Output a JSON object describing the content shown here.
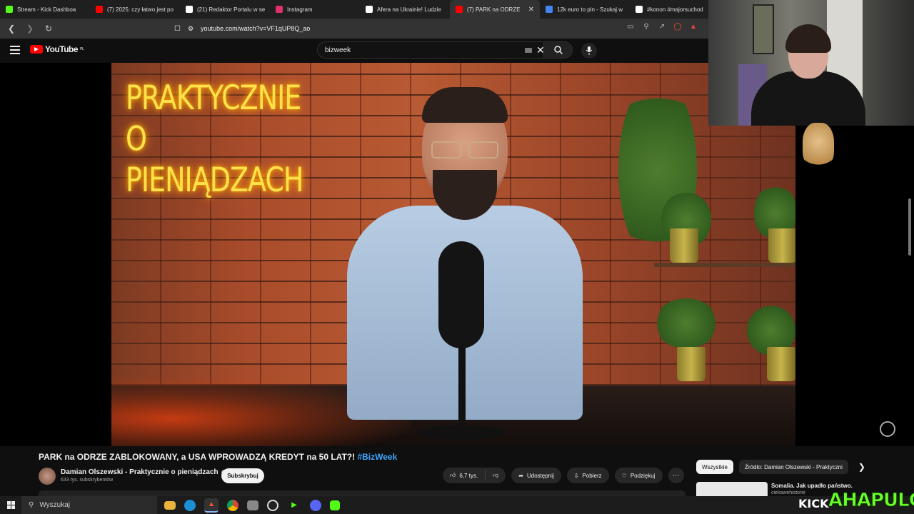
{
  "browser": {
    "tabs": [
      {
        "title": "Stream - Kick Dashboa",
        "icon": "kick-icon",
        "color": "#53fc18"
      },
      {
        "title": "(7) 2025: czy łatwo jest po",
        "icon": "youtube-icon",
        "color": "#ff0000"
      },
      {
        "title": "(21) Redaktor Portalu w se",
        "icon": "x-icon",
        "color": "#ffffff"
      },
      {
        "title": "Instagram",
        "icon": "instagram-icon",
        "color": "#e1306c"
      },
      {
        "title": "Afera na Ukrainie! Ludzie",
        "icon": "tiktok-icon",
        "color": "#ffffff"
      },
      {
        "title": "(7) PARK na ODRZE",
        "icon": "youtube-icon",
        "color": "#ff0000",
        "active": true
      },
      {
        "title": "12k euro to pln - Szukaj w",
        "icon": "google-icon",
        "color": "#4285f4"
      },
      {
        "title": "#konon #majorsuchod",
        "icon": "tiktok-icon",
        "color": "#ffffff"
      }
    ],
    "url": "youtube.com/watch?v=VF1qUP8Q_ao"
  },
  "youtube": {
    "logo_text": "YouTube",
    "region": "PL",
    "search_value": "bizweek"
  },
  "video": {
    "neon_line1": "PRAKTYCZNIE O",
    "neon_line2": "PIENIĄDZACH",
    "title": "PARK na ODRZE ZABLOKOWANY, a USA WPROWADZĄ KREDYT na 50 LAT?!",
    "hashtag": "#BizWeek"
  },
  "channel": {
    "name": "Damian Olszewski - Praktycznie o pieniądzach",
    "subscribers": "633 tys. subskrybentów",
    "subscribe_label": "Subskrybuj"
  },
  "actions": {
    "likes": "6,7 tys.",
    "share": "Udostępnij",
    "download": "Pobierz",
    "thanks": "Podziękuj"
  },
  "sidebar": {
    "chips": [
      "Wszystkie",
      "Źródło: Damian Olszewski - Praktyczni"
    ],
    "reco_title": "Somalia. Jak upadło państwo.",
    "reco_channel": "ciekawehistorie"
  },
  "taskbar": {
    "search_placeholder": "Wyszukaj"
  },
  "overlay": {
    "kick": "KICK",
    "streamer": "AHAPULCO"
  }
}
